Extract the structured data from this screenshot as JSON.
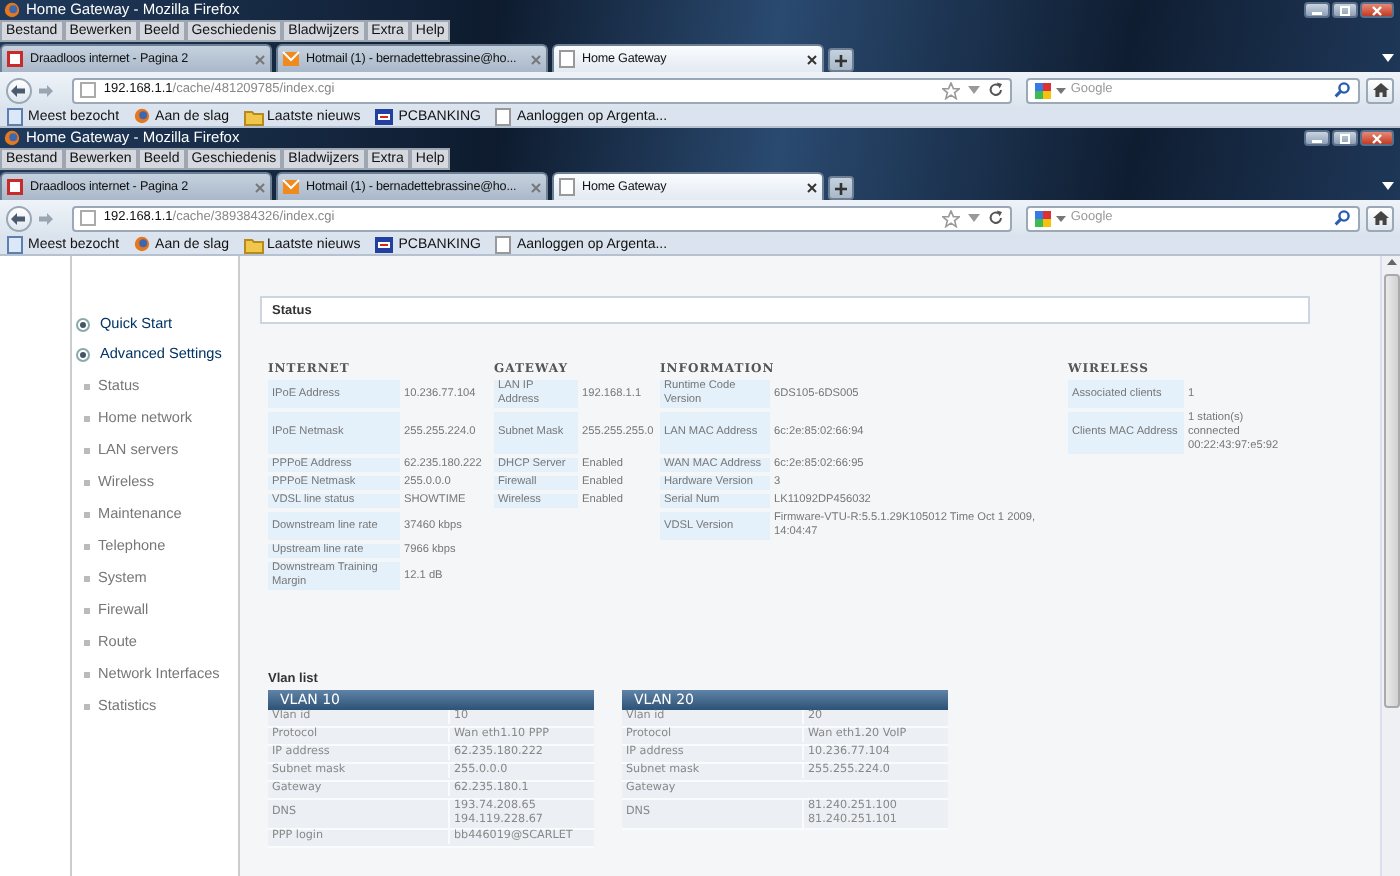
{
  "windows": [
    {
      "title": "Home Gateway - Mozilla Firefox",
      "menu": [
        "Bestand",
        "Bewerken",
        "Beeld",
        "Geschiedenis",
        "Bladwijzers",
        "Extra",
        "Help"
      ],
      "tabs": [
        {
          "label": "Draadloos internet - Pagina 2",
          "selected": false,
          "kind": "red"
        },
        {
          "label": "Hotmail (1) - bernadettebrassine@ho...",
          "selected": false,
          "kind": "orange"
        },
        {
          "label": "Home Gateway",
          "selected": true,
          "kind": "blank"
        }
      ],
      "url": {
        "host": "192.168.1.1",
        "path": "/cache/481209785/index.cgi"
      },
      "search": {
        "placeholder": "Google"
      },
      "bookmarks": [
        {
          "label": "Meest bezocht",
          "kind": "page"
        },
        {
          "label": "Aan de slag",
          "kind": "firefox"
        },
        {
          "label": "Laatste nieuws",
          "kind": "feed"
        },
        {
          "label": "PCBANKING",
          "kind": "bank"
        },
        {
          "label": "Aanloggen op Argenta...",
          "kind": "blank"
        }
      ]
    },
    {
      "title": "Home Gateway - Mozilla Firefox",
      "menu": [
        "Bestand",
        "Bewerken",
        "Beeld",
        "Geschiedenis",
        "Bladwijzers",
        "Extra",
        "Help"
      ],
      "tabs": [
        {
          "label": "Draadloos internet - Pagina 2",
          "selected": false,
          "kind": "red"
        },
        {
          "label": "Hotmail (1) - bernadettebrassine@ho...",
          "selected": false,
          "kind": "orange"
        },
        {
          "label": "Home Gateway",
          "selected": true,
          "kind": "blank"
        }
      ],
      "url": {
        "host": "192.168.1.1",
        "path": "/cache/389384326/index.cgi"
      },
      "search": {
        "placeholder": "Google"
      },
      "bookmarks": [
        {
          "label": "Meest bezocht",
          "kind": "page"
        },
        {
          "label": "Aan de slag",
          "kind": "firefox"
        },
        {
          "label": "Laatste nieuws",
          "kind": "feed"
        },
        {
          "label": "PCBANKING",
          "kind": "bank"
        },
        {
          "label": "Aanloggen op Argenta...",
          "kind": "blank"
        }
      ]
    }
  ],
  "sidebar": {
    "items": [
      {
        "label": "Quick Start",
        "kind": "section"
      },
      {
        "label": "Advanced Settings",
        "kind": "section"
      },
      {
        "label": "Status",
        "kind": "link"
      },
      {
        "label": "Home network",
        "kind": "link"
      },
      {
        "label": "LAN servers",
        "kind": "link"
      },
      {
        "label": "Wireless",
        "kind": "link"
      },
      {
        "label": "Maintenance",
        "kind": "link"
      },
      {
        "label": "Telephone",
        "kind": "link"
      },
      {
        "label": "System",
        "kind": "link"
      },
      {
        "label": "Firewall",
        "kind": "link"
      },
      {
        "label": "Route",
        "kind": "link"
      },
      {
        "label": "Network Interfaces",
        "kind": "link"
      },
      {
        "label": "Statistics",
        "kind": "link"
      }
    ]
  },
  "status": {
    "title": "Status",
    "groups": [
      {
        "heading": "INTERNET",
        "rows": [
          {
            "label": "IPoE Address",
            "value": "10.236.77.104"
          },
          {
            "label": "IPoE Netmask",
            "value": "255.255.224.0"
          },
          {
            "label": "PPPoE Address",
            "value": "62.235.180.222"
          },
          {
            "label": "PPPoE Netmask",
            "value": "255.0.0.0"
          },
          {
            "label": "VDSL line status",
            "value": "SHOWTIME"
          },
          {
            "label": "Downstream line rate",
            "value": "37460 kbps"
          },
          {
            "label": "Upstream line rate",
            "value": "7966 kbps"
          },
          {
            "label": "Downstream Training Margin",
            "value": "12.1 dB"
          }
        ]
      },
      {
        "heading": "GATEWAY",
        "rows": [
          {
            "label": "LAN IP Address",
            "value": "192.168.1.1"
          },
          {
            "label": "Subnet Mask",
            "value": "255.255.255.0"
          },
          {
            "label": "DHCP Server",
            "value": "Enabled"
          },
          {
            "label": "Firewall",
            "value": "Enabled"
          },
          {
            "label": "Wireless",
            "value": "Enabled"
          }
        ]
      },
      {
        "heading": "INFORMATION",
        "rows": [
          {
            "label": "Runtime Code Version",
            "value": "6DS105-6DS005"
          },
          {
            "label": "LAN MAC Address",
            "value": "6c:2e:85:02:66:94"
          },
          {
            "label": "WAN MAC Address",
            "value": "6c:2e:85:02:66:95"
          },
          {
            "label": "Hardware Version",
            "value": "3"
          },
          {
            "label": "Serial Num",
            "value": "LK11092DP456032"
          },
          {
            "label": "VDSL Version",
            "value": "Firmware-VTU-R:5.5.1.29K105012 Time Oct 1 2009, 14:04:47"
          }
        ]
      },
      {
        "heading": "WIRELESS",
        "rows": [
          {
            "label": "Associated clients",
            "value": "1"
          },
          {
            "label": "Clients MAC Address",
            "value": "1 station(s) connected 00:22:43:97:e5:92"
          }
        ]
      }
    ]
  },
  "vlan_list": {
    "title": "Vlan list",
    "tables": [
      {
        "heading": "VLAN 10",
        "rows": [
          {
            "label": "Vlan id",
            "value": "10"
          },
          {
            "label": "Protocol",
            "value": "Wan eth1.10 PPP"
          },
          {
            "label": "IP address",
            "value": "62.235.180.222"
          },
          {
            "label": "Subnet mask",
            "value": "255.0.0.0"
          },
          {
            "label": "Gateway",
            "value": "62.235.180.1"
          },
          {
            "label": "DNS",
            "value": "193.74.208.65 194.119.228.67"
          },
          {
            "label": "PPP login",
            "value": "bb446019@SCARLET"
          }
        ]
      },
      {
        "heading": "VLAN 20",
        "rows": [
          {
            "label": "Vlan id",
            "value": "20"
          },
          {
            "label": "Protocol",
            "value": "Wan eth1.20 VoIP"
          },
          {
            "label": "IP address",
            "value": "10.236.77.104"
          },
          {
            "label": "Subnet mask",
            "value": "255.255.224.0"
          },
          {
            "label": "Gateway"
          },
          {
            "label": "DNS",
            "value": "81.240.251.100 81.240.251.101"
          }
        ]
      }
    ]
  }
}
